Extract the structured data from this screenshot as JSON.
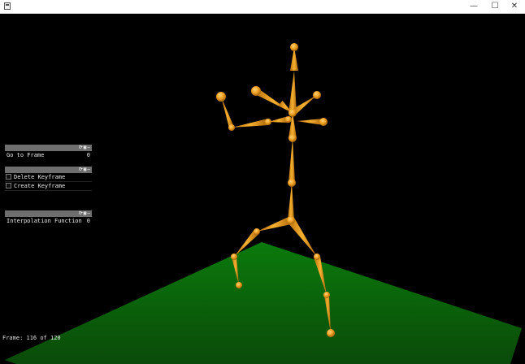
{
  "window": {
    "icon": "app-window-icon",
    "controls": {
      "minimize": "—",
      "maximize": "☐",
      "close": "✕"
    }
  },
  "panels": {
    "goto": {
      "icons": "⟳▣–",
      "label": "Go to Frame",
      "value": "0"
    },
    "keyframe": {
      "icons": "⟳▣–",
      "items": [
        {
          "label": "Delete Keyframe",
          "checked": false
        },
        {
          "label": "Create Keyframe",
          "checked": false
        }
      ]
    },
    "interpolation": {
      "icons": "⟳▣–",
      "label": "Interpolation Function",
      "value": "0"
    }
  },
  "status": {
    "frame_text": "Frame: 116 of 120",
    "current_frame": 116,
    "total_frames": 120
  },
  "colors": {
    "bone": "#f0a020",
    "bone_shadow": "#a86a10",
    "floor": "#0f6a0f",
    "panel_header": "#6e6e6e"
  }
}
